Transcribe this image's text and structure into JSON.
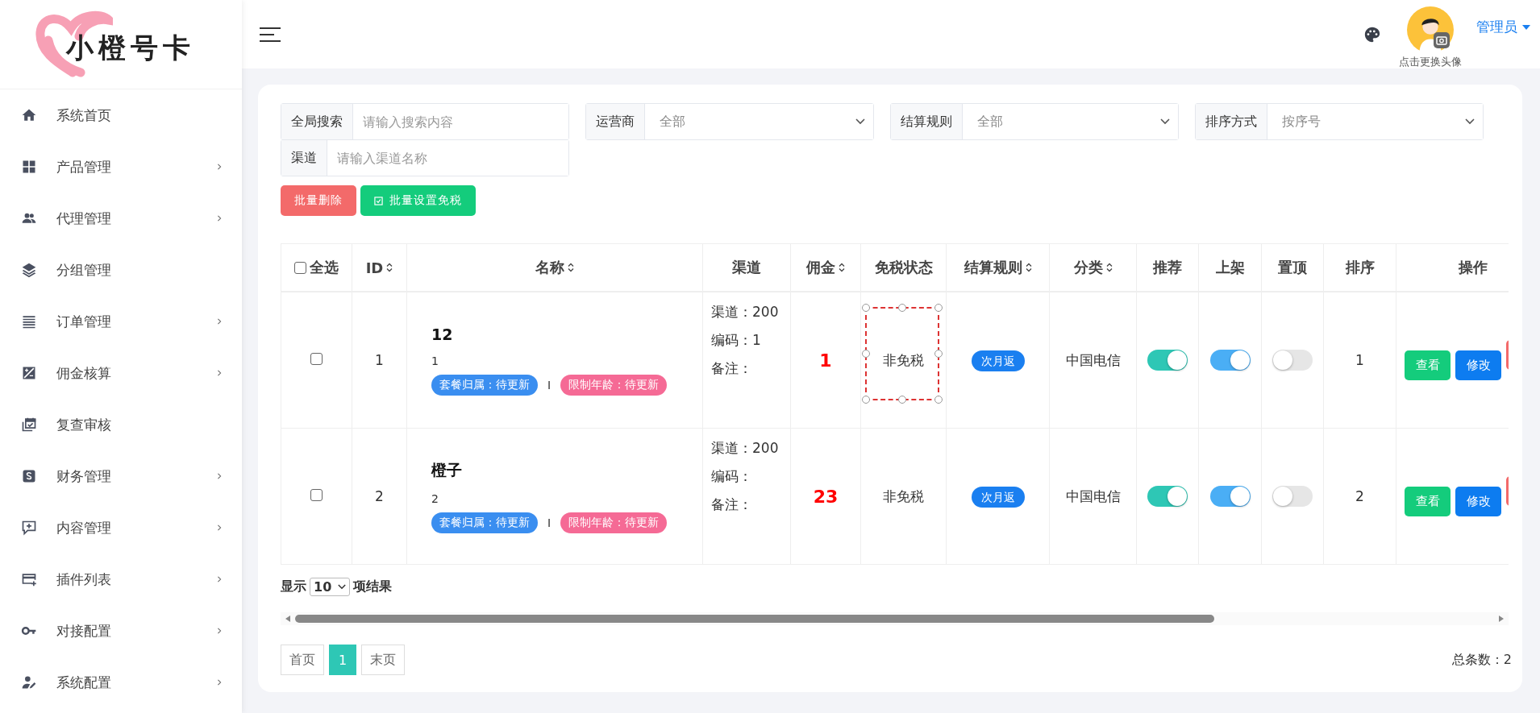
{
  "sidebar": {
    "logo_text": "小橙号卡",
    "items": [
      {
        "label": "系统首页",
        "has_submenu": false
      },
      {
        "label": "产品管理",
        "has_submenu": true
      },
      {
        "label": "代理管理",
        "has_submenu": true
      },
      {
        "label": "分组管理",
        "has_submenu": false
      },
      {
        "label": "订单管理",
        "has_submenu": true
      },
      {
        "label": "佣金核算",
        "has_submenu": true
      },
      {
        "label": "复查审核",
        "has_submenu": false
      },
      {
        "label": "财务管理",
        "has_submenu": true
      },
      {
        "label": "内容管理",
        "has_submenu": true
      },
      {
        "label": "插件列表",
        "has_submenu": true
      },
      {
        "label": "对接配置",
        "has_submenu": true
      },
      {
        "label": "系统配置",
        "has_submenu": true
      }
    ]
  },
  "header": {
    "avatar_caption": "点击更换头像",
    "user_name": "管理员"
  },
  "filters": [
    {
      "kind": "input",
      "label": "全局搜索",
      "placeholder": "请输入搜索内容"
    },
    {
      "kind": "select",
      "label": "运营商",
      "value": "全部"
    },
    {
      "kind": "select",
      "label": "结算规则",
      "value": "全部"
    },
    {
      "kind": "select",
      "label": "排序方式",
      "value": "按序号"
    },
    {
      "kind": "input",
      "label": "渠道",
      "placeholder": "请输入渠道名称"
    }
  ],
  "actions": [
    {
      "kind": "danger",
      "label": "批量删除"
    },
    {
      "kind": "success",
      "label": "批量设置免税"
    }
  ],
  "table": {
    "select_all": {
      "label": "全选",
      "checked": false
    },
    "columns": [
      {
        "label": "ID",
        "sortable": true
      },
      {
        "label": "名称",
        "sortable": true
      },
      {
        "label": "渠道",
        "sortable": false
      },
      {
        "label": "佣金",
        "sortable": true
      },
      {
        "label": "免税状态",
        "sortable": false
      },
      {
        "label": "结算规则",
        "sortable": true
      },
      {
        "label": "分类",
        "sortable": true
      },
      {
        "label": "推荐",
        "sortable": false
      },
      {
        "label": "上架",
        "sortable": false
      },
      {
        "label": "置顶",
        "sortable": false
      },
      {
        "label": "排序",
        "sortable": false
      },
      {
        "label": "操作",
        "sortable": false
      }
    ],
    "rows": [
      {
        "checked": false,
        "id": "1",
        "name": "12",
        "code": "1",
        "tags": [
          {
            "text": "套餐归属：待更新",
            "color": "#3a8ef0"
          },
          {
            "text": "限制年龄：待更新",
            "color": "#f56a95"
          }
        ],
        "separator": "I",
        "channel": [
          "渠道：200",
          "编码：1",
          "备注："
        ],
        "commission": "1",
        "tax": "非免税",
        "tax_selected": true,
        "settle": "次月返",
        "category": "中国电信",
        "toggles": [
          {
            "on": true
          },
          {
            "on": true
          },
          {
            "on": false
          }
        ],
        "sort": "1",
        "buttons": [
          {
            "kind": "view",
            "label": "查看"
          },
          {
            "kind": "edit",
            "label": "修改"
          },
          {
            "kind": "delete"
          }
        ]
      },
      {
        "checked": false,
        "id": "2",
        "name": "橙子",
        "code": "2",
        "tags": [
          {
            "text": "套餐归属：待更新",
            "color": "#3a8ef0"
          },
          {
            "text": "限制年龄：待更新",
            "color": "#f56a95"
          }
        ],
        "separator": "I",
        "channel": [
          "渠道：200",
          "编码：",
          "备注："
        ],
        "commission": "23",
        "tax": "非免税",
        "tax_selected": false,
        "settle": "次月返",
        "category": "中国电信",
        "toggles": [
          {
            "on": true
          },
          {
            "on": true
          },
          {
            "on": false
          }
        ],
        "sort": "2",
        "buttons": [
          {
            "kind": "view",
            "label": "查看"
          },
          {
            "kind": "edit",
            "label": "修改"
          },
          {
            "kind": "delete"
          }
        ]
      }
    ]
  },
  "footer": {
    "show_label": "显示",
    "page_size": "10",
    "results_label": "项结果",
    "pages": [
      {
        "label": "首页",
        "selected": false
      },
      {
        "label": "1",
        "selected": true
      },
      {
        "label": "末页",
        "selected": false
      }
    ],
    "total": "总条数：2"
  }
}
